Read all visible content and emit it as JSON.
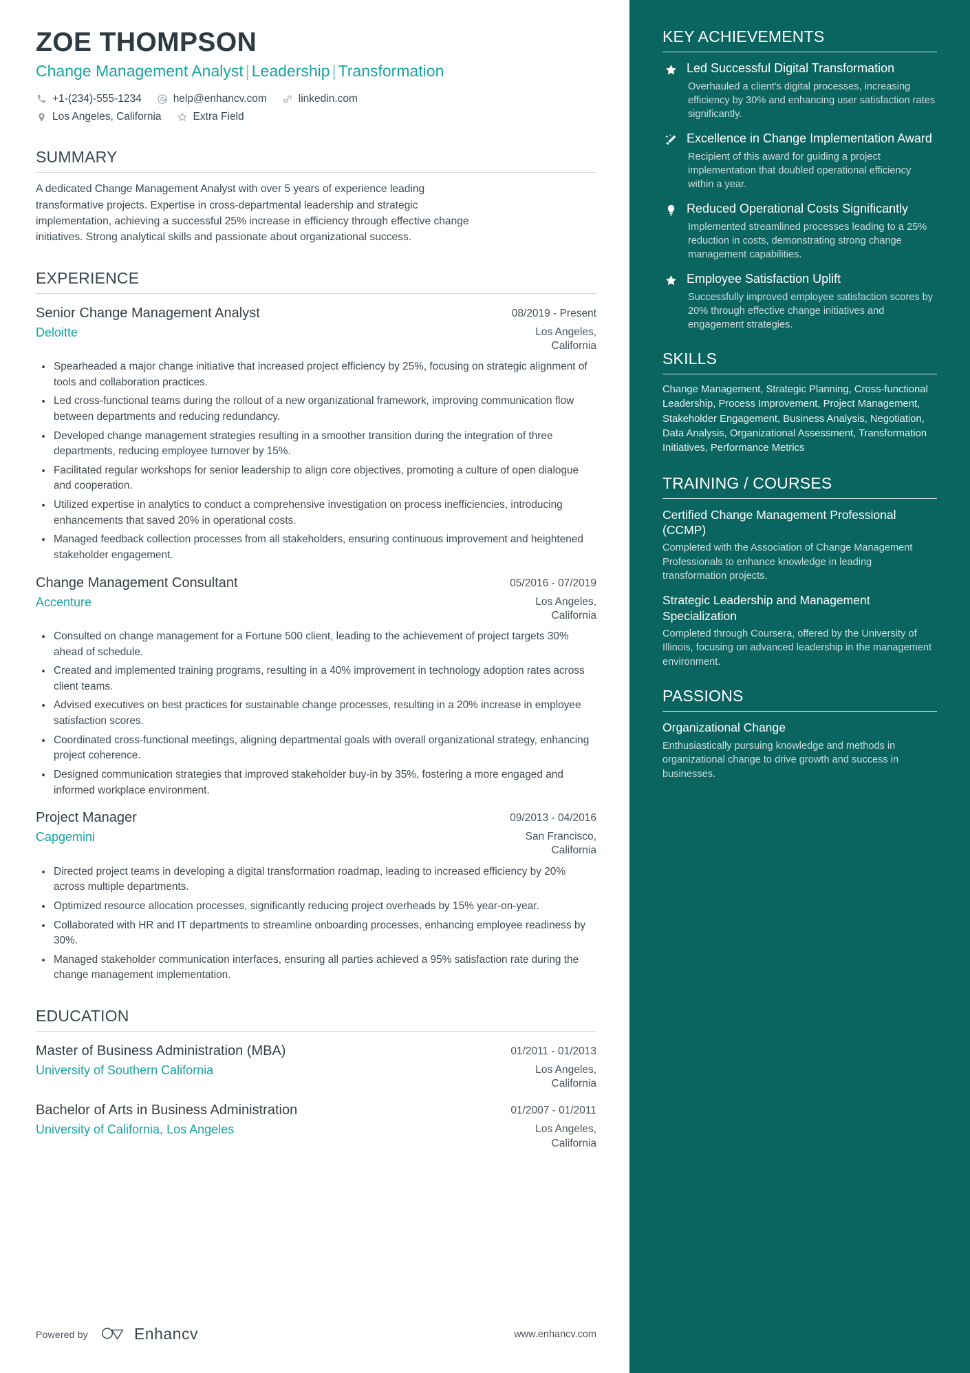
{
  "colors": {
    "sidebar_bg": "#0a6460",
    "accent_teal": "#1aa3a3",
    "heading": "#394750",
    "body_text": "#3e4a52"
  },
  "header": {
    "name": "ZOE THOMPSON",
    "headline_parts": [
      "Change Management Analyst",
      "Leadership",
      "Transformation"
    ],
    "headline_separator": "|",
    "contacts": [
      {
        "icon": "phone-icon",
        "text": "+1-(234)-555-1234"
      },
      {
        "icon": "email-icon",
        "text": "help@enhancv.com"
      },
      {
        "icon": "link-icon",
        "text": "linkedin.com"
      },
      {
        "icon": "location-icon",
        "text": "Los Angeles, California"
      },
      {
        "icon": "star-outline-icon",
        "text": "Extra Field"
      }
    ]
  },
  "summary": {
    "title": "SUMMARY",
    "text": "A dedicated Change Management Analyst with over 5 years of experience leading transformative projects. Expertise in cross-departmental leadership and strategic implementation, achieving a successful 25% increase in efficiency through effective change initiatives. Strong analytical skills and passionate about organizational success."
  },
  "experience": {
    "title": "EXPERIENCE",
    "entries": [
      {
        "title": "Senior Change Management Analyst",
        "date": "08/2019 - Present",
        "org": "Deloitte",
        "location": "Los Angeles, California",
        "bullets": [
          "Spearheaded a major change initiative that increased project efficiency by 25%, focusing on strategic alignment of tools and collaboration practices.",
          "Led cross-functional teams during the rollout of a new organizational framework, improving communication flow between departments and reducing redundancy.",
          "Developed change management strategies resulting in a smoother transition during the integration of three departments, reducing employee turnover by 15%.",
          "Facilitated regular workshops for senior leadership to align core objectives, promoting a culture of open dialogue and cooperation.",
          "Utilized expertise in analytics to conduct a comprehensive investigation on process inefficiencies, introducing enhancements that saved 20% in operational costs.",
          "Managed feedback collection processes from all stakeholders, ensuring continuous improvement and heightened stakeholder engagement."
        ]
      },
      {
        "title": "Change Management Consultant",
        "date": "05/2016 - 07/2019",
        "org": "Accenture",
        "location": "Los Angeles, California",
        "bullets": [
          "Consulted on change management for a Fortune 500 client, leading to the achievement of project targets 30% ahead of schedule.",
          "Created and implemented training programs, resulting in a 40% improvement in technology adoption rates across client teams.",
          "Advised executives on best practices for sustainable change processes, resulting in a 20% increase in employee satisfaction scores.",
          "Coordinated cross-functional meetings, aligning departmental goals with overall organizational strategy, enhancing project coherence.",
          "Designed communication strategies that improved stakeholder buy-in by 35%, fostering a more engaged and informed workplace environment."
        ]
      },
      {
        "title": "Project Manager",
        "date": "09/2013 - 04/2016",
        "org": "Capgemini",
        "location": "San Francisco, California",
        "bullets": [
          "Directed project teams in developing a digital transformation roadmap, leading to increased efficiency by 20% across multiple departments.",
          "Optimized resource allocation processes, significantly reducing project overheads by 15% year-on-year.",
          "Collaborated with HR and IT departments to streamline onboarding processes, enhancing employee readiness by 30%.",
          "Managed stakeholder communication interfaces, ensuring all parties achieved a 95% satisfaction rate during the change management implementation."
        ]
      }
    ]
  },
  "education": {
    "title": "EDUCATION",
    "entries": [
      {
        "title": "Master of Business Administration (MBA)",
        "date": "01/2011 - 01/2013",
        "org": "University of Southern California",
        "location": "Los Angeles, California"
      },
      {
        "title": "Bachelor of Arts in Business Administration",
        "date": "01/2007 - 01/2011",
        "org": "University of California, Los Angeles",
        "location": "Los Angeles, California"
      }
    ]
  },
  "footer": {
    "powered_by": "Powered by",
    "brand": "Enhancv",
    "url": "www.enhancv.com"
  },
  "sidebar": {
    "achievements": {
      "title": "KEY ACHIEVEMENTS",
      "items": [
        {
          "icon": "star-icon",
          "title": "Led Successful Digital Transformation",
          "desc": "Overhauled a client's digital processes, increasing efficiency by 30% and enhancing user satisfaction rates significantly."
        },
        {
          "icon": "magic-wand-icon",
          "title": "Excellence in Change Implementation Award",
          "desc": "Recipient of this award for guiding a project implementation that doubled operational efficiency within a year."
        },
        {
          "icon": "lightbulb-icon",
          "title": "Reduced Operational Costs Significantly",
          "desc": "Implemented streamlined processes leading to a 25% reduction in costs, demonstrating strong change management capabilities."
        },
        {
          "icon": "star-icon",
          "title": "Employee Satisfaction Uplift",
          "desc": "Successfully improved employee satisfaction scores by 20% through effective change initiatives and engagement strategies."
        }
      ]
    },
    "skills": {
      "title": "SKILLS",
      "text": "Change Management, Strategic Planning, Cross-functional Leadership, Process Improvement, Project Management, Stakeholder Engagement, Business Analysis, Negotiation, Data Analysis, Organizational Assessment, Transformation Initiatives, Performance Metrics"
    },
    "training": {
      "title": "TRAINING / COURSES",
      "items": [
        {
          "title": "Certified Change Management Professional (CCMP)",
          "desc": "Completed with the Association of Change Management Professionals to enhance knowledge in leading transformation projects."
        },
        {
          "title": "Strategic Leadership and Management Specialization",
          "desc": "Completed through Coursera, offered by the University of Illinois, focusing on advanced leadership in the management environment."
        }
      ]
    },
    "passions": {
      "title": "PASSIONS",
      "items": [
        {
          "title": "Organizational Change",
          "desc": "Enthusiastically pursuing knowledge and methods in organizational change to drive growth and success in businesses."
        }
      ]
    }
  }
}
